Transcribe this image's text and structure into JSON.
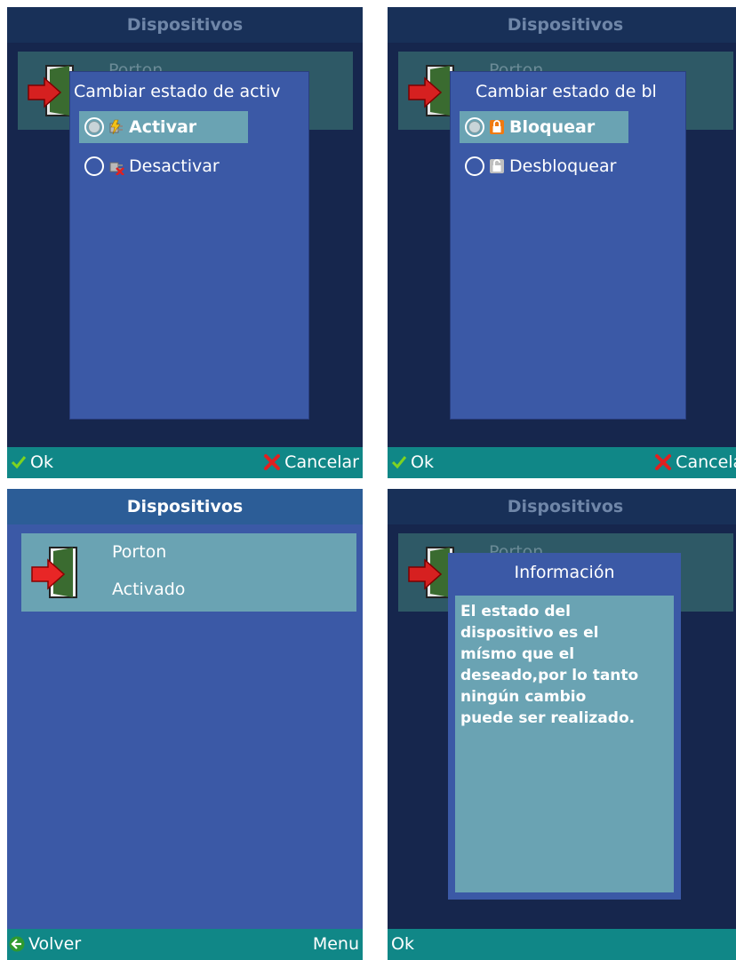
{
  "app_title": "Dispositivos",
  "device": {
    "name": "Porton",
    "status_peek": "Porton",
    "status": "Activado"
  },
  "screen1": {
    "popup_title": "Cambiar estado de activ",
    "options": [
      {
        "label": "Activar",
        "selected": true
      },
      {
        "label": "Desactivar",
        "selected": false
      }
    ],
    "soft_left": "Ok",
    "soft_right": "Cancelar"
  },
  "screen2": {
    "popup_title": "Cambiar estado de bl",
    "options": [
      {
        "label": "Bloquear",
        "selected": true
      },
      {
        "label": "Desbloquear",
        "selected": false
      }
    ],
    "soft_left": "Ok",
    "soft_right": "Cancelar"
  },
  "screen3": {
    "soft_left": "Volver",
    "soft_right": "Menu"
  },
  "screen4": {
    "popup_title": "Información",
    "message": "El estado del dispositivo es el mísmo que el deseado,por lo tanto ningún cambio puede ser realizado.",
    "message_lines": [
      "El estado del",
      "dispositivo es el",
      "mísmo que el",
      "deseado,por lo tanto",
      "ningún cambio",
      "puede ser realizado."
    ],
    "soft_left": "Ok"
  },
  "colors": {
    "softbar": "#108787",
    "popup": "#3b59a6",
    "selected": "#6aa3b3",
    "title_bright": "#2c5d97"
  }
}
